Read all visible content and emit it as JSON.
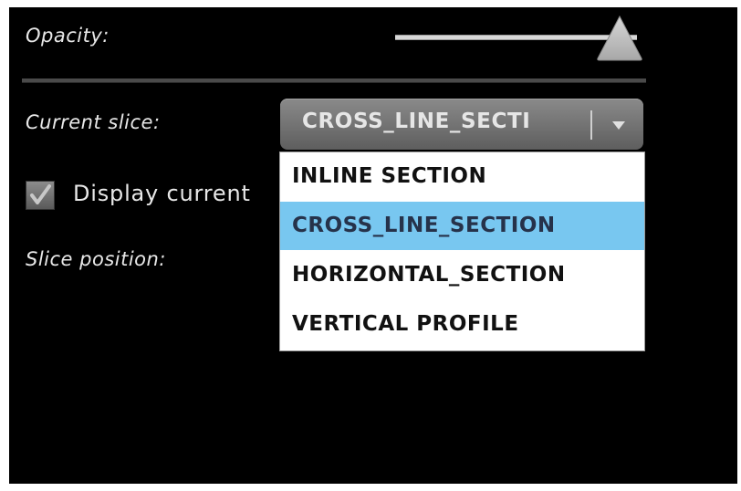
{
  "opacity": {
    "label": "Opacity:",
    "value": 1.0
  },
  "current_slice": {
    "label": "Current slice:",
    "selected_display": "CROSS_LINE_SECTI",
    "options": [
      "INLINE SECTION",
      "CROSS_LINE_SECTION",
      "HORIZONTAL_SECTION",
      "VERTICAL PROFILE"
    ],
    "highlighted": "CROSS_LINE_SECTION"
  },
  "display_current": {
    "label": "Display current",
    "checked": true
  },
  "slice_position": {
    "label": "Slice position:"
  },
  "colors": {
    "panel_bg": "#000000",
    "highlight": "#78c7f0"
  },
  "icons": {
    "slider_thumb": "triangle-thumb-icon",
    "dropdown_arrow": "chevron-down-icon",
    "checkmark": "checkmark-icon"
  }
}
